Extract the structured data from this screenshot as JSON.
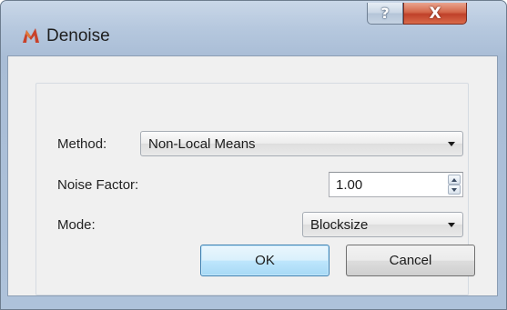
{
  "window": {
    "title": "Denoise",
    "app_icon": "matlab-logo-icon",
    "help_glyph": "?",
    "close_glyph": "X"
  },
  "form": {
    "method": {
      "label": "Method:",
      "value": "Non-Local Means"
    },
    "noise_factor": {
      "label": "Noise Factor:",
      "value": "1.00"
    },
    "mode": {
      "label": "Mode:",
      "value": "Blocksize"
    }
  },
  "buttons": {
    "ok": "OK",
    "cancel": "Cancel"
  },
  "colors": {
    "title_bar": "#b6c8de",
    "close_button": "#c94b30",
    "default_button": "#bee6fd",
    "dialog_body": "#f0f0f0"
  }
}
